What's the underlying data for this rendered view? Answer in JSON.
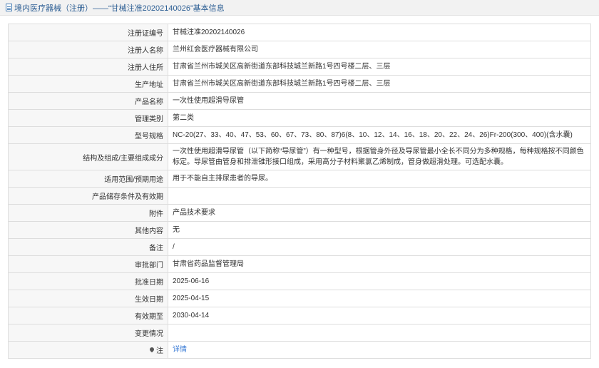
{
  "header": {
    "title": "境内医疗器械（注册）——“甘械注准20202140026”基本信息",
    "icon": "document-icon"
  },
  "rows": [
    {
      "label": "注册证编号",
      "value": "甘械注准20202140026"
    },
    {
      "label": "注册人名称",
      "value": "兰州红会医疗器械有限公司"
    },
    {
      "label": "注册人住所",
      "value": "甘肃省兰州市城关区高新街道东部科技城兰新路1号四号楼二层、三层"
    },
    {
      "label": "生产地址",
      "value": "甘肃省兰州市城关区高新街道东部科技城兰新路1号四号楼二层、三层"
    },
    {
      "label": "产品名称",
      "value": "一次性使用超滑导尿管"
    },
    {
      "label": "管理类别",
      "value": "第二类"
    },
    {
      "label": "型号规格",
      "value": "NC-20(27、33、40、47、53、60、67、73、80、87)6(8、10、12、14、16、18、20、22、24、26)Fr-200(300、400)(含水囊)"
    },
    {
      "label": "结构及组成/主要组成成分",
      "value": "一次性使用超滑导尿管（以下简称“导尿管”）有一种型号，根据管身外径及导尿管最小全长不同分为多种规格，每种规格按不同颜色标定。导尿管由管身和排泄锥形接口组成，采用高分子材料聚氯乙烯制成，管身做超滑处理。可选配水囊。"
    },
    {
      "label": "适用范围/预期用途",
      "value": "用于不能自主排尿患者的导尿。"
    },
    {
      "label": "产品储存条件及有效期",
      "value": ""
    },
    {
      "label": "附件",
      "value": "产品技术要求"
    },
    {
      "label": "其他内容",
      "value": "无"
    },
    {
      "label": "备注",
      "value": "/"
    },
    {
      "label": "审批部门",
      "value": "甘肃省药品监督管理局"
    },
    {
      "label": "批准日期",
      "value": "2025-06-16"
    },
    {
      "label": "生效日期",
      "value": "2025-04-15"
    },
    {
      "label": "有效期至",
      "value": "2030-04-14"
    },
    {
      "label": "变更情况",
      "value": ""
    },
    {
      "label": "注",
      "value": "详情",
      "icon": "pin-icon"
    }
  ]
}
